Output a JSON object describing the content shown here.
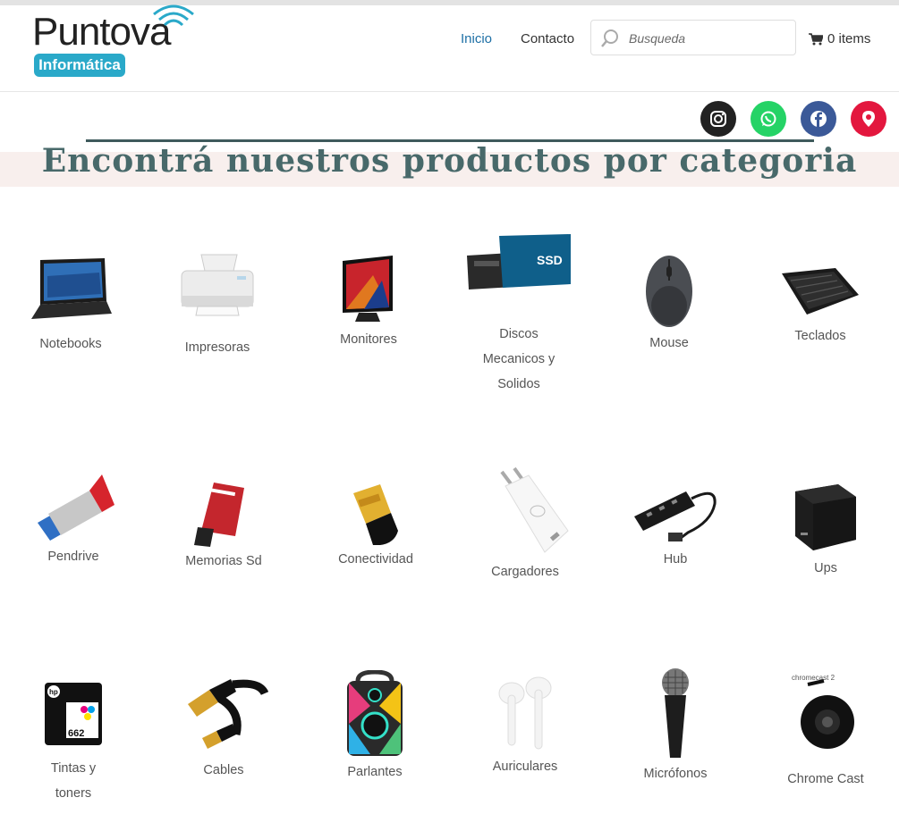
{
  "brand": {
    "name": "Puntova",
    "subtitle": "Informática"
  },
  "nav": {
    "inicio": "Inicio",
    "contacto": "Contacto"
  },
  "search": {
    "placeholder": "Busqueda"
  },
  "cart": {
    "label": "0 items"
  },
  "social": [
    "instagram-icon",
    "whatsapp-icon",
    "facebook-icon",
    "location-pin-icon"
  ],
  "colors": {
    "accent_nav": "#1d6fa5",
    "heading": "#48696a",
    "band": "#f8efed",
    "whatsapp": "#25d366",
    "facebook": "#3b5998",
    "location": "#e3173e"
  },
  "section": {
    "title": "Encontrá nuestros productos por categoria"
  },
  "categories": [
    {
      "label": "Notebooks",
      "icon": "notebook-icon"
    },
    {
      "label": "Impresoras",
      "icon": "printer-icon"
    },
    {
      "label": "Monitores",
      "icon": "monitor-icon"
    },
    {
      "label": "Discos Mecanicos y Solidos",
      "icon": "ssd-icon"
    },
    {
      "label": "Mouse",
      "icon": "mouse-icon"
    },
    {
      "label": "Teclados",
      "icon": "keyboard-icon"
    },
    {
      "label": "Pendrive",
      "icon": "pendrive-icon"
    },
    {
      "label": "Memorias Sd",
      "icon": "sd-card-icon"
    },
    {
      "label": "Conectividad",
      "icon": "wifi-adapter-icon"
    },
    {
      "label": "Cargadores",
      "icon": "charger-icon"
    },
    {
      "label": "Hub",
      "icon": "usb-hub-icon"
    },
    {
      "label": "Ups",
      "icon": "ups-icon"
    },
    {
      "label": "Tintas y toners",
      "icon": "ink-cartridge-icon"
    },
    {
      "label": "Cables",
      "icon": "hdmi-cable-icon"
    },
    {
      "label": "Parlantes",
      "icon": "speaker-icon"
    },
    {
      "label": "Auriculares",
      "icon": "earbuds-icon"
    },
    {
      "label": "Micrófonos",
      "icon": "microphone-icon"
    },
    {
      "label": "Chrome Cast",
      "icon": "chromecast-icon"
    }
  ],
  "image_text": {
    "ssd_box": "SSD",
    "ink": "662",
    "chromecast": "chromecast 2"
  }
}
